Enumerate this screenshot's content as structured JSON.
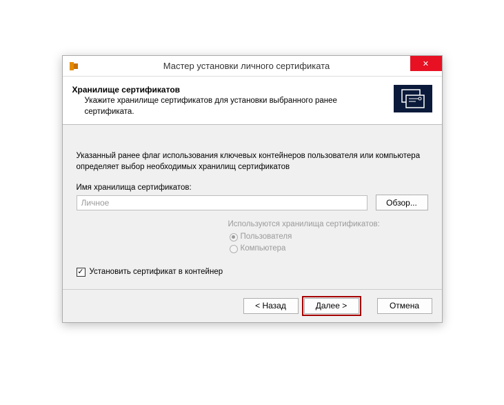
{
  "titlebar": {
    "title": "Мастер установки личного сертификата",
    "close_symbol": "✕"
  },
  "header": {
    "title": "Хранилище сертификатов",
    "subtitle": "Укажите хранилище сертификатов для установки выбранного ранее сертификата."
  },
  "body": {
    "info": "Указанный ранее флаг использования ключевых контейнеров пользователя или компьютера определяет выбор необходимых хранилищ сертификатов",
    "store_label": "Имя хранилища сертификатов:",
    "store_value": "Личное",
    "browse_label": "Обзор...",
    "storage_title": "Используются хранилища сертификатов:",
    "radio_user": "Пользователя",
    "radio_computer": "Компьютера",
    "checkbox_label": "Установить сертификат в контейнер"
  },
  "footer": {
    "back": "< Назад",
    "next": "Далее >",
    "cancel": "Отмена"
  }
}
